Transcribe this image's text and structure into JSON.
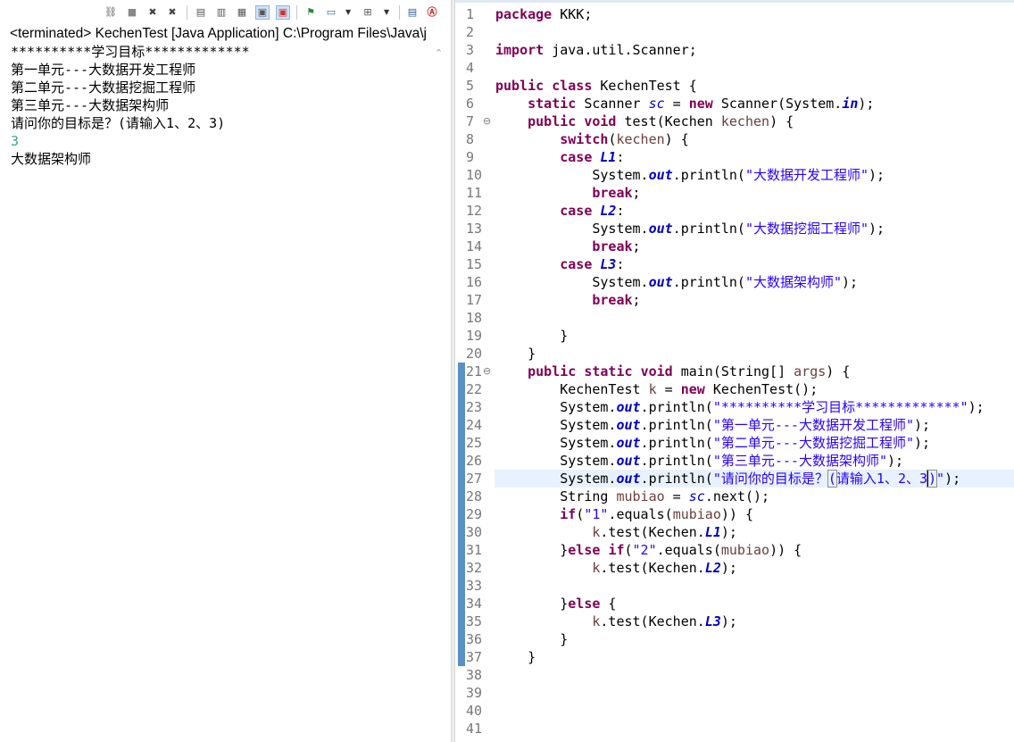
{
  "console": {
    "title": "<terminated> KechenTest [Java Application] C:\\Program Files\\Java\\j",
    "lines": [
      {
        "text": "**********学习目标*************",
        "kind": "out"
      },
      {
        "text": "第一单元---大数据开发工程师",
        "kind": "out"
      },
      {
        "text": "第二单元---大数据挖掘工程师",
        "kind": "out"
      },
      {
        "text": "第三单元---大数据架构师",
        "kind": "out"
      },
      {
        "text": "请问你的目标是？(请输入1、2、3)",
        "kind": "out"
      },
      {
        "text": "3",
        "kind": "input"
      },
      {
        "text": "大数据架构师",
        "kind": "out"
      }
    ],
    "toolbar_icons": [
      "pin-console-icon",
      "terminate-icon",
      "remove-launch-icon",
      "remove-all-terminated-icon",
      "clear-console-icon",
      "scroll-lock-icon",
      "word-wrap-icon",
      "show-on-stdout-icon",
      "show-on-stderr-icon",
      "pin-icon",
      "display-selected-console-icon",
      "open-console-icon",
      "console-list-icon",
      "error-log-icon"
    ]
  },
  "editor": {
    "current_line": 27,
    "lines": [
      {
        "n": "1",
        "tokens": [
          [
            "kw",
            "package"
          ],
          [
            "p",
            " KKK;"
          ]
        ]
      },
      {
        "n": "2",
        "tokens": []
      },
      {
        "n": "3",
        "tokens": [
          [
            "kw",
            "import"
          ],
          [
            "p",
            " java.util.Scanner;"
          ]
        ]
      },
      {
        "n": "4",
        "tokens": []
      },
      {
        "n": "5",
        "tokens": [
          [
            "kw",
            "public"
          ],
          [
            "p",
            " "
          ],
          [
            "kw",
            "class"
          ],
          [
            "p",
            " KechenTest {"
          ]
        ]
      },
      {
        "n": "6",
        "tokens": [
          [
            "p",
            "    "
          ],
          [
            "kw",
            "static"
          ],
          [
            "p",
            " Scanner "
          ],
          [
            "sf",
            "sc"
          ],
          [
            "p",
            " = "
          ],
          [
            "kw",
            "new"
          ],
          [
            "p",
            " Scanner(System."
          ],
          [
            "fld",
            "in"
          ],
          [
            "p",
            ");"
          ]
        ]
      },
      {
        "n": "7",
        "fold": "⊖",
        "tokens": [
          [
            "p",
            "    "
          ],
          [
            "kw",
            "public"
          ],
          [
            "p",
            " "
          ],
          [
            "kw",
            "void"
          ],
          [
            "p",
            " test(Kechen "
          ],
          [
            "var",
            "kechen"
          ],
          [
            "p",
            ") {"
          ]
        ]
      },
      {
        "n": "8",
        "tokens": [
          [
            "p",
            "        "
          ],
          [
            "kw",
            "switch"
          ],
          [
            "p",
            "("
          ],
          [
            "var",
            "kechen"
          ],
          [
            "p",
            ") {"
          ]
        ]
      },
      {
        "n": "9",
        "tokens": [
          [
            "p",
            "        "
          ],
          [
            "kw",
            "case"
          ],
          [
            "p",
            " "
          ],
          [
            "cst",
            "L1"
          ],
          [
            "p",
            ":"
          ]
        ]
      },
      {
        "n": "10",
        "tokens": [
          [
            "p",
            "            System."
          ],
          [
            "fld",
            "out"
          ],
          [
            "p",
            ".println("
          ],
          [
            "str",
            "\"大数据开发工程师\""
          ],
          [
            "p",
            ");"
          ]
        ]
      },
      {
        "n": "11",
        "tokens": [
          [
            "p",
            "            "
          ],
          [
            "kw",
            "break"
          ],
          [
            "p",
            ";"
          ]
        ]
      },
      {
        "n": "12",
        "tokens": [
          [
            "p",
            "        "
          ],
          [
            "kw",
            "case"
          ],
          [
            "p",
            " "
          ],
          [
            "cst",
            "L2"
          ],
          [
            "p",
            ":"
          ]
        ]
      },
      {
        "n": "13",
        "tokens": [
          [
            "p",
            "            System."
          ],
          [
            "fld",
            "out"
          ],
          [
            "p",
            ".println("
          ],
          [
            "str",
            "\"大数据挖掘工程师\""
          ],
          [
            "p",
            ");"
          ]
        ]
      },
      {
        "n": "14",
        "tokens": [
          [
            "p",
            "            "
          ],
          [
            "kw",
            "break"
          ],
          [
            "p",
            ";"
          ]
        ]
      },
      {
        "n": "15",
        "tokens": [
          [
            "p",
            "        "
          ],
          [
            "kw",
            "case"
          ],
          [
            "p",
            " "
          ],
          [
            "cst",
            "L3"
          ],
          [
            "p",
            ":"
          ]
        ]
      },
      {
        "n": "16",
        "tokens": [
          [
            "p",
            "            System."
          ],
          [
            "fld",
            "out"
          ],
          [
            "p",
            ".println("
          ],
          [
            "str",
            "\"大数据架构师\""
          ],
          [
            "p",
            ");"
          ]
        ]
      },
      {
        "n": "17",
        "tokens": [
          [
            "p",
            "            "
          ],
          [
            "kw",
            "break"
          ],
          [
            "p",
            ";"
          ]
        ]
      },
      {
        "n": "18",
        "tokens": []
      },
      {
        "n": "19",
        "tokens": [
          [
            "p",
            "        }"
          ]
        ]
      },
      {
        "n": "20",
        "tokens": [
          [
            "p",
            "    }"
          ]
        ]
      },
      {
        "n": "21",
        "fold": "⊖",
        "tokens": [
          [
            "p",
            "    "
          ],
          [
            "kw",
            "public"
          ],
          [
            "p",
            " "
          ],
          [
            "kw",
            "static"
          ],
          [
            "p",
            " "
          ],
          [
            "kw",
            "void"
          ],
          [
            "p",
            " main(String[] "
          ],
          [
            "var",
            "args"
          ],
          [
            "p",
            ") {"
          ]
        ]
      },
      {
        "n": "22",
        "tokens": [
          [
            "p",
            "        KechenTest "
          ],
          [
            "var",
            "k"
          ],
          [
            "p",
            " = "
          ],
          [
            "kw",
            "new"
          ],
          [
            "p",
            " KechenTest();"
          ]
        ]
      },
      {
        "n": "23",
        "tokens": [
          [
            "p",
            "        System."
          ],
          [
            "fld",
            "out"
          ],
          [
            "p",
            ".println("
          ],
          [
            "str",
            "\"**********学习目标*************\""
          ],
          [
            "p",
            ");"
          ]
        ]
      },
      {
        "n": "24",
        "tokens": [
          [
            "p",
            "        System."
          ],
          [
            "fld",
            "out"
          ],
          [
            "p",
            ".println("
          ],
          [
            "str",
            "\"第一单元---大数据开发工程师\""
          ],
          [
            "p",
            ");"
          ]
        ]
      },
      {
        "n": "25",
        "tokens": [
          [
            "p",
            "        System."
          ],
          [
            "fld",
            "out"
          ],
          [
            "p",
            ".println("
          ],
          [
            "str",
            "\"第二单元---大数据挖掘工程师\""
          ],
          [
            "p",
            ");"
          ]
        ]
      },
      {
        "n": "26",
        "tokens": [
          [
            "p",
            "        System."
          ],
          [
            "fld",
            "out"
          ],
          [
            "p",
            ".println("
          ],
          [
            "str",
            "\"第三单元---大数据架构师\""
          ],
          [
            "p",
            ");"
          ]
        ]
      },
      {
        "n": "27",
        "tokens": [
          [
            "p",
            "        System."
          ],
          [
            "fld",
            "out"
          ],
          [
            "p",
            ".println("
          ],
          [
            "str",
            "\"请问你的目标是？"
          ],
          [
            "strm",
            "("
          ],
          [
            "str",
            "请输入1、2、3"
          ],
          [
            "strc",
            ")"
          ],
          [
            "str",
            "\""
          ],
          [
            "p",
            ");"
          ]
        ]
      },
      {
        "n": "28",
        "tokens": [
          [
            "p",
            "        String "
          ],
          [
            "var",
            "mubiao"
          ],
          [
            "p",
            " = "
          ],
          [
            "sf",
            "sc"
          ],
          [
            "p",
            ".next();"
          ]
        ]
      },
      {
        "n": "29",
        "tokens": [
          [
            "p",
            "        "
          ],
          [
            "kw",
            "if"
          ],
          [
            "p",
            "("
          ],
          [
            "str",
            "\"1\""
          ],
          [
            "p",
            ".equals("
          ],
          [
            "var",
            "mubiao"
          ],
          [
            "p",
            ")) {"
          ]
        ]
      },
      {
        "n": "30",
        "tokens": [
          [
            "p",
            "            "
          ],
          [
            "var",
            "k"
          ],
          [
            "p",
            ".test(Kechen."
          ],
          [
            "cst",
            "L1"
          ],
          [
            "p",
            ");"
          ]
        ]
      },
      {
        "n": "31",
        "tokens": [
          [
            "p",
            "        }"
          ],
          [
            "kw",
            "else"
          ],
          [
            "p",
            " "
          ],
          [
            "kw",
            "if"
          ],
          [
            "p",
            "("
          ],
          [
            "str",
            "\"2\""
          ],
          [
            "p",
            ".equals("
          ],
          [
            "var",
            "mubiao"
          ],
          [
            "p",
            ")) {"
          ]
        ]
      },
      {
        "n": "32",
        "tokens": [
          [
            "p",
            "            "
          ],
          [
            "var",
            "k"
          ],
          [
            "p",
            ".test(Kechen."
          ],
          [
            "cst",
            "L2"
          ],
          [
            "p",
            ");"
          ]
        ]
      },
      {
        "n": "33",
        "tokens": []
      },
      {
        "n": "34",
        "tokens": [
          [
            "p",
            "        }"
          ],
          [
            "kw",
            "else"
          ],
          [
            "p",
            " {"
          ]
        ]
      },
      {
        "n": "35",
        "tokens": [
          [
            "p",
            "            "
          ],
          [
            "var",
            "k"
          ],
          [
            "p",
            ".test(Kechen."
          ],
          [
            "cst",
            "L3"
          ],
          [
            "p",
            ");"
          ]
        ]
      },
      {
        "n": "36",
        "tokens": [
          [
            "p",
            "        }"
          ]
        ]
      },
      {
        "n": "37",
        "tokens": [
          [
            "p",
            "    }"
          ]
        ]
      },
      {
        "n": "38",
        "tokens": []
      },
      {
        "n": "39",
        "tokens": []
      },
      {
        "n": "40",
        "tokens": []
      },
      {
        "n": "41",
        "tokens": []
      }
    ]
  }
}
